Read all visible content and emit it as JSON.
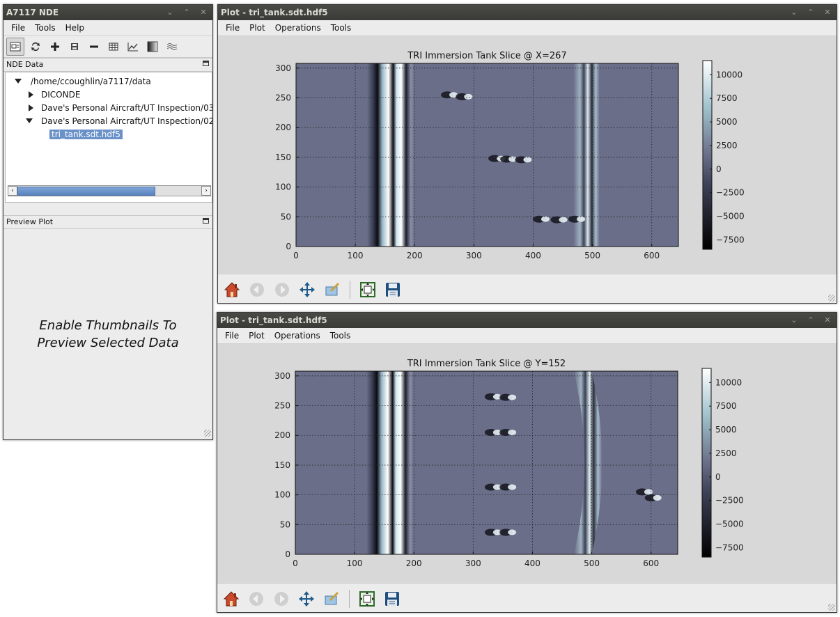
{
  "main_window": {
    "title": "A7117 NDE",
    "menu": [
      "File",
      "Tools",
      "Help"
    ],
    "toolbar_icons": [
      "preview-toggle-icon",
      "refresh-icon",
      "add-icon",
      "save-small-icon",
      "remove-icon",
      "table-icon",
      "plot-icon",
      "gradient-icon",
      "mesh-icon"
    ],
    "nde_data_header": "NDE Data",
    "tree": {
      "root": "/home/ccoughlin/a7117/data",
      "items": [
        "DICONDE",
        "Dave's Personal Aircraft/UT Inspection/03",
        "Dave's Personal Aircraft/UT Inspection/02"
      ],
      "selected_file": "tri_tank.sdt.hdf5"
    },
    "preview_header": "Preview Plot",
    "preview_message_line1": "Enable Thumbnails To",
    "preview_message_line2": "Preview Selected Data"
  },
  "plot_windows": [
    {
      "title": "Plot - tri_tank.sdt.hdf5",
      "menu": [
        "File",
        "Plot",
        "Operations",
        "Tools"
      ],
      "chart_title": "TRI Immersion Tank Slice @ X=267"
    },
    {
      "title": "Plot - tri_tank.sdt.hdf5",
      "menu": [
        "File",
        "Plot",
        "Operations",
        "Tools"
      ],
      "chart_title": "TRI Immersion Tank Slice @ Y=152"
    }
  ],
  "colors": {
    "title_bar": "#3e3e3b",
    "selection": "#6a92c8",
    "plot_field": "#6a6e88"
  },
  "chart_data": [
    {
      "type": "heatmap",
      "title": "TRI Immersion Tank Slice @ X=267",
      "xlabel": "",
      "ylabel": "",
      "xlim": [
        0,
        645
      ],
      "ylim": [
        0,
        308
      ],
      "x_ticks": [
        "0",
        "100",
        "200",
        "300",
        "400",
        "500",
        "600"
      ],
      "y_ticks": [
        "0",
        "50",
        "100",
        "150",
        "200",
        "250",
        "300"
      ],
      "colorbar_ticks": [
        "10000",
        "7500",
        "5000",
        "2500",
        "0",
        "−2500",
        "−5000",
        "−7500"
      ],
      "clim": [
        -8500,
        11500
      ],
      "grid": true
    },
    {
      "type": "heatmap",
      "title": "TRI Immersion Tank Slice @ Y=152",
      "xlabel": "",
      "ylabel": "",
      "xlim": [
        0,
        645
      ],
      "ylim": [
        0,
        308
      ],
      "x_ticks": [
        "0",
        "100",
        "200",
        "300",
        "400",
        "500",
        "600"
      ],
      "y_ticks": [
        "0",
        "50",
        "100",
        "150",
        "200",
        "250",
        "300"
      ],
      "colorbar_ticks": [
        "10000",
        "7500",
        "5000",
        "2500",
        "0",
        "−2500",
        "−5000",
        "−7500"
      ],
      "clim": [
        -8500,
        11500
      ],
      "grid": true
    }
  ]
}
